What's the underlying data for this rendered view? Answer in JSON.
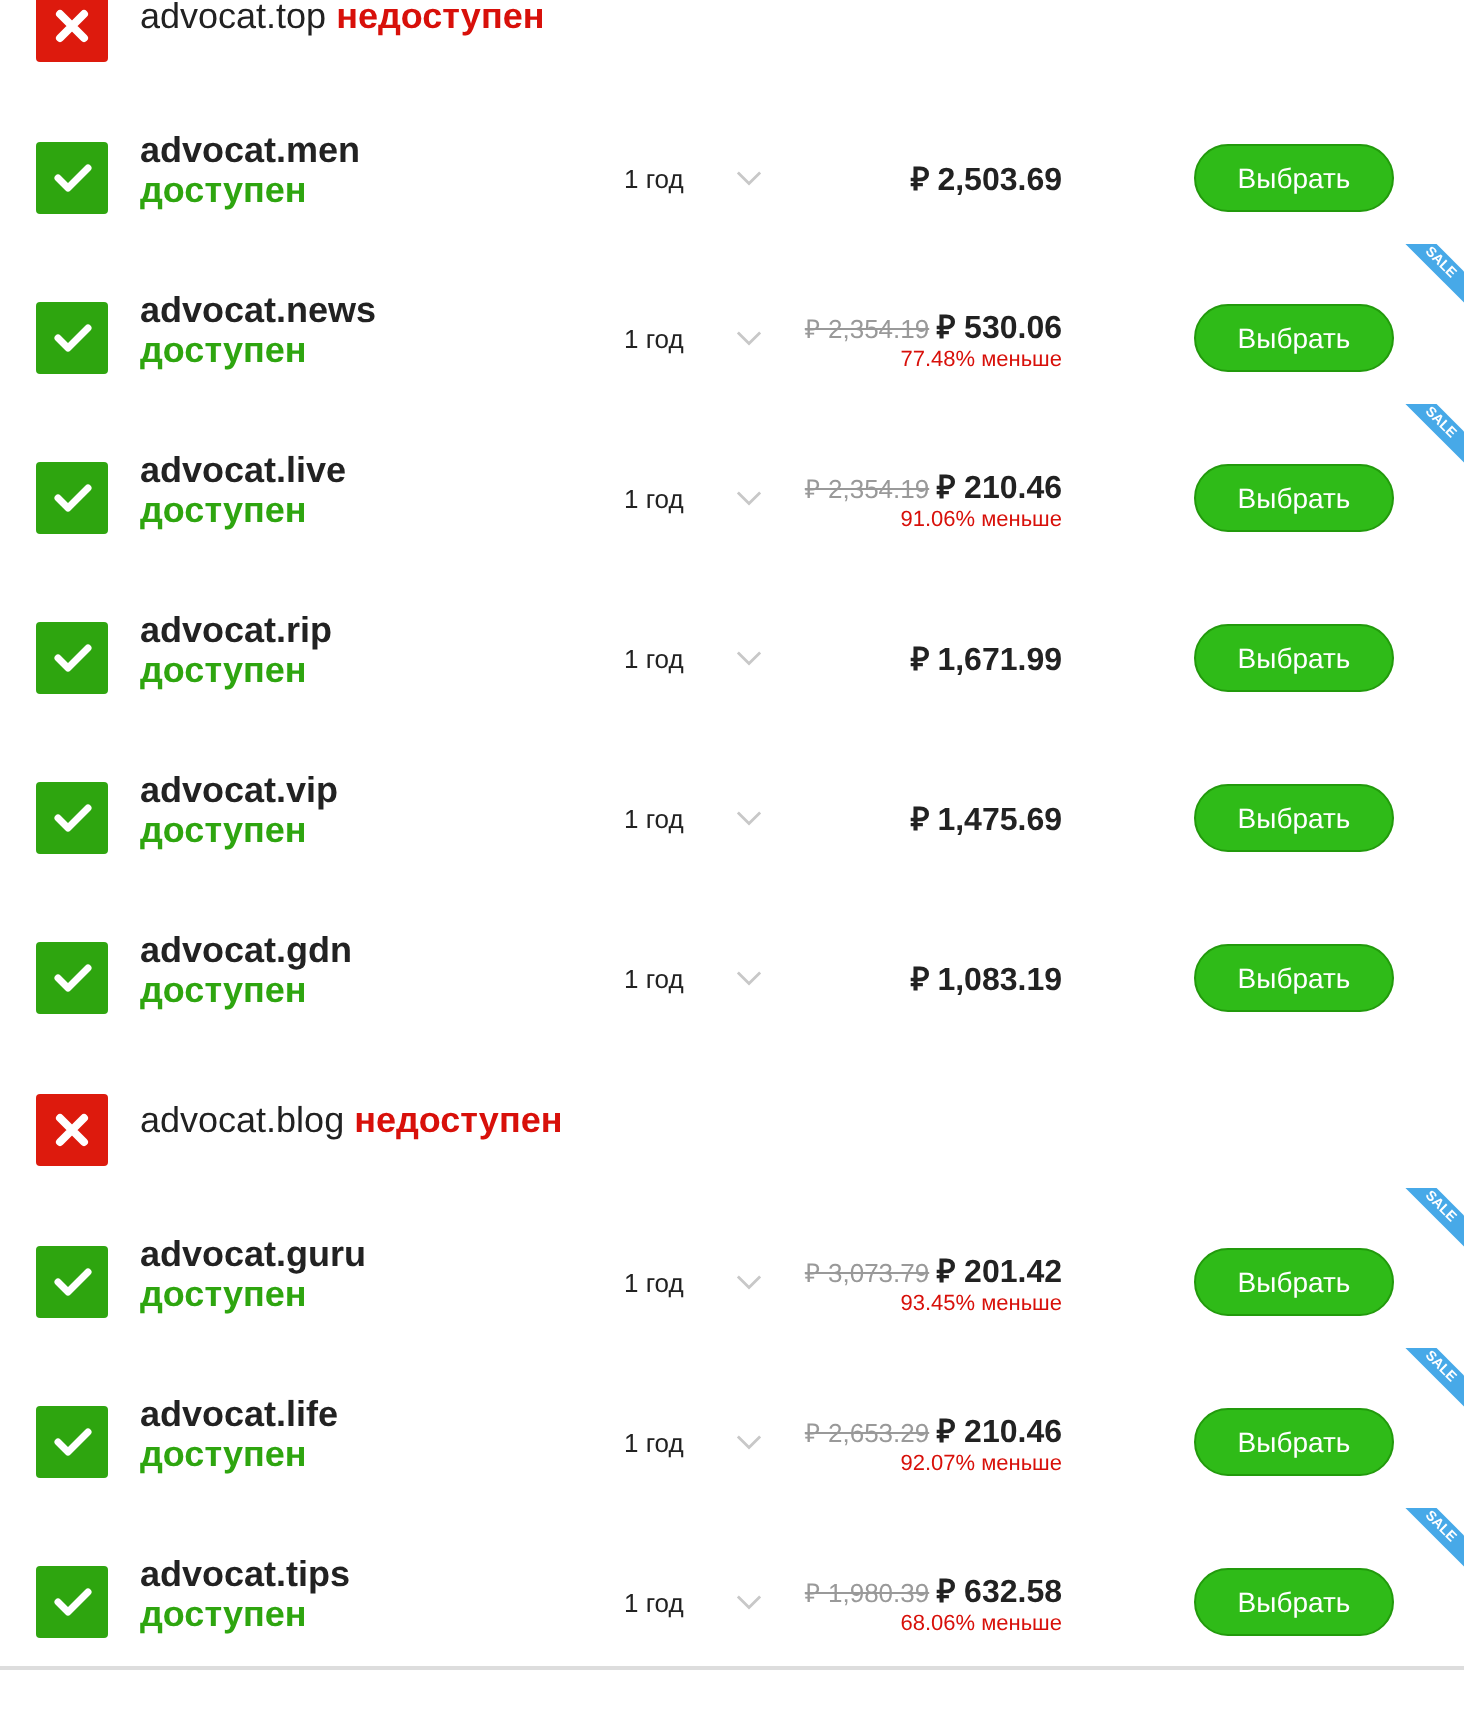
{
  "domains": [
    {
      "kind": "unavailable",
      "name": "advocat.top",
      "status": "недоступен"
    },
    {
      "kind": "available",
      "name": "advocat.men",
      "status": "доступен",
      "period": "1 год",
      "price": "₽ 2,503.69",
      "button": "Выбрать"
    },
    {
      "kind": "available",
      "name": "advocat.news",
      "status": "доступен",
      "period": "1 год",
      "old_price": "₽ 2,354.19",
      "price": "₽ 530.06",
      "discount": "77.48% меньше",
      "ribbon": "SALE",
      "button": "Выбрать"
    },
    {
      "kind": "available",
      "name": "advocat.live",
      "status": "доступен",
      "period": "1 год",
      "old_price": "₽ 2,354.19",
      "price": "₽ 210.46",
      "discount": "91.06% меньше",
      "ribbon": "SALE",
      "button": "Выбрать"
    },
    {
      "kind": "available",
      "name": "advocat.rip",
      "status": "доступен",
      "period": "1 год",
      "price": "₽ 1,671.99",
      "button": "Выбрать"
    },
    {
      "kind": "available",
      "name": "advocat.vip",
      "status": "доступен",
      "period": "1 год",
      "price": "₽ 1,475.69",
      "button": "Выбрать"
    },
    {
      "kind": "available",
      "name": "advocat.gdn",
      "status": "доступен",
      "period": "1 год",
      "price": "₽ 1,083.19",
      "button": "Выбрать"
    },
    {
      "kind": "unavailable",
      "name": "advocat.blog",
      "status": "недоступен"
    },
    {
      "kind": "available",
      "name": "advocat.guru",
      "status": "доступен",
      "period": "1 год",
      "old_price": "₽ 3,073.79",
      "price": "₽ 201.42",
      "discount": "93.45% меньше",
      "ribbon": "SALE",
      "button": "Выбрать"
    },
    {
      "kind": "available",
      "name": "advocat.life",
      "status": "доступен",
      "period": "1 год",
      "old_price": "₽ 2,653.29",
      "price": "₽ 210.46",
      "discount": "92.07% меньше",
      "ribbon": "SALE",
      "button": "Выбрать"
    },
    {
      "kind": "available",
      "name": "advocat.tips",
      "status": "доступен",
      "period": "1 год",
      "old_price": "₽ 1,980.39",
      "price": "₽ 632.58",
      "discount": "68.06% меньше",
      "ribbon": "SALE",
      "button": "Выбрать"
    }
  ]
}
